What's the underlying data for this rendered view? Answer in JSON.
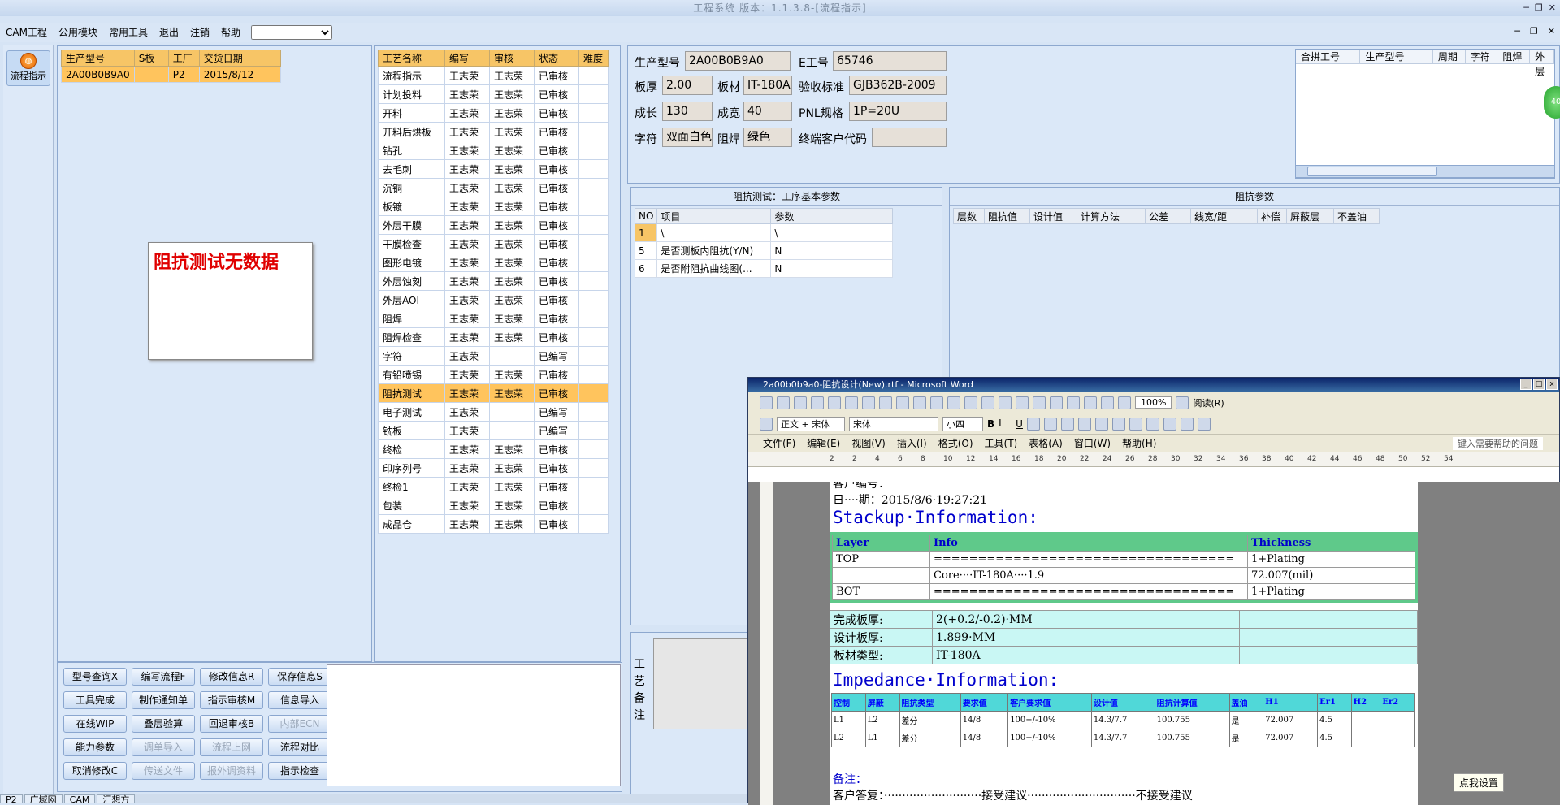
{
  "app": {
    "title": "工程系统 版本：1.1.3.8-[流程指示]",
    "menu": [
      "CAM工程",
      "公用模块",
      "常用工具",
      "退出",
      "注销",
      "帮助"
    ],
    "menu_select_value": ""
  },
  "leftbar": {
    "flow_button": "流程指示"
  },
  "orders": {
    "headers": [
      "生产型号",
      "S板",
      "工厂",
      "交货日期"
    ],
    "rows": [
      [
        "2A00B0B9A0",
        "",
        "P2",
        "2015/8/12"
      ]
    ]
  },
  "message": "阻抗测试无数据",
  "process": {
    "headers": [
      "工艺名称",
      "编写",
      "审核",
      "状态",
      "难度"
    ],
    "rows": [
      [
        "流程指示",
        "王志荣",
        "王志荣",
        "已审核",
        ""
      ],
      [
        "计划投料",
        "王志荣",
        "王志荣",
        "已审核",
        ""
      ],
      [
        "开料",
        "王志荣",
        "王志荣",
        "已审核",
        ""
      ],
      [
        "开料后烘板",
        "王志荣",
        "王志荣",
        "已审核",
        ""
      ],
      [
        "钻孔",
        "王志荣",
        "王志荣",
        "已审核",
        ""
      ],
      [
        "去毛刺",
        "王志荣",
        "王志荣",
        "已审核",
        ""
      ],
      [
        "沉铜",
        "王志荣",
        "王志荣",
        "已审核",
        ""
      ],
      [
        "板镀",
        "王志荣",
        "王志荣",
        "已审核",
        ""
      ],
      [
        "外层干膜",
        "王志荣",
        "王志荣",
        "已审核",
        ""
      ],
      [
        "干膜检查",
        "王志荣",
        "王志荣",
        "已审核",
        ""
      ],
      [
        "图形电镀",
        "王志荣",
        "王志荣",
        "已审核",
        ""
      ],
      [
        "外层蚀刻",
        "王志荣",
        "王志荣",
        "已审核",
        ""
      ],
      [
        "外层AOI",
        "王志荣",
        "王志荣",
        "已审核",
        ""
      ],
      [
        "阻焊",
        "王志荣",
        "王志荣",
        "已审核",
        ""
      ],
      [
        "阻焊检查",
        "王志荣",
        "王志荣",
        "已审核",
        ""
      ],
      [
        "字符",
        "王志荣",
        "",
        "已编写",
        ""
      ],
      [
        "有铅喷锡",
        "王志荣",
        "王志荣",
        "已审核",
        ""
      ],
      [
        "阻抗测试",
        "王志荣",
        "王志荣",
        "已审核",
        ""
      ],
      [
        "电子测试",
        "王志荣",
        "",
        "已编写",
        ""
      ],
      [
        "铣板",
        "王志荣",
        "",
        "已编写",
        ""
      ],
      [
        "终检",
        "王志荣",
        "王志荣",
        "已审核",
        ""
      ],
      [
        "印序列号",
        "王志荣",
        "王志荣",
        "已审核",
        ""
      ],
      [
        "终检1",
        "王志荣",
        "王志荣",
        "已审核",
        ""
      ],
      [
        "包装",
        "王志荣",
        "王志荣",
        "已审核",
        ""
      ],
      [
        "成品仓",
        "王志荣",
        "王志荣",
        "已审核",
        ""
      ]
    ],
    "selected_index": 17
  },
  "buttons": [
    [
      "型号查询X",
      "编写流程F",
      "修改信息R",
      "保存信息S"
    ],
    [
      "工具完成",
      "制作通知单",
      "指示审核M",
      "信息导入"
    ],
    [
      "在线WIP",
      "叠层验算",
      "回退审核B",
      "内部ECN"
    ],
    [
      "能力参数",
      "调单导入",
      "流程上网",
      "流程对比"
    ],
    [
      "取消修改C",
      "传送文件",
      "报外调资料",
      "指示检查"
    ]
  ],
  "disabled_buttons": [
    "内部ECN",
    "调单导入",
    "流程上网",
    "传送文件",
    "报外调资料"
  ],
  "info": {
    "prod_label": "生产型号",
    "prod": "2A00B0B9A0",
    "e_label": "E工号",
    "e": "65746",
    "thick_label": "板厚",
    "thick": "2.00",
    "mat_label": "板材",
    "mat": "IT-180A",
    "std_label": "验收标准",
    "std": "GJB362B-2009",
    "len_label": "成长",
    "len": "130",
    "wid_label": "成宽",
    "wid": "40",
    "pnl_label": "PNL规格",
    "pnl": "1P=20U",
    "char_label": "字符",
    "char": "双面白色",
    "mask_label": "阻焊",
    "mask": "绿色",
    "cust_label": "终端客户代码",
    "cust": ""
  },
  "merge_headers": [
    "合拼工号",
    "生产型号",
    "周期",
    "字符",
    "阻焊",
    "外层"
  ],
  "badge": "40",
  "imp_basic": {
    "title": "阻抗测试：工序基本参数",
    "headers": [
      "NO",
      "项目",
      "参数"
    ],
    "rows": [
      [
        "1",
        "\\",
        "\\"
      ],
      [
        "5",
        "是否测板内阻抗(Y/N)",
        "N"
      ],
      [
        "6",
        "是否附阻抗曲线图(...",
        "N"
      ]
    ]
  },
  "imp_params": {
    "title": "阻抗参数",
    "headers": [
      "层数",
      "阻抗值",
      "设计值",
      "计算方法",
      "公差",
      "线宽/距",
      "补偿",
      "屏蔽层",
      "不盖油"
    ]
  },
  "remark_label": "工艺备注",
  "word": {
    "title": "2a00b0b9a0-阻抗设计(New).rtf - Microsoft Word",
    "zoom": "100%",
    "read": "阅读(R)",
    "style": "正文 + 宋体",
    "font": "宋体",
    "size": "小四",
    "menu": [
      "文件(F)",
      "编辑(E)",
      "视图(V)",
      "插入(I)",
      "格式(O)",
      "工具(T)",
      "表格(A)",
      "窗口(W)",
      "帮助(H)"
    ],
    "help_box": "键入需要帮助的问题",
    "ruler": [
      "2",
      "2",
      "4",
      "6",
      "8",
      "10",
      "12",
      "14",
      "16",
      "18",
      "20",
      "22",
      "24",
      "26",
      "28",
      "30",
      "32",
      "34",
      "36",
      "38",
      "40",
      "42",
      "44",
      "46",
      "48",
      "50",
      "52",
      "54"
    ],
    "cust_no": "客户编号：",
    "date": "日····期：2015/8/6·19:27:21",
    "stack_head": "Stackup·Information:",
    "stack_cols": [
      "Layer",
      "Info",
      "Thickness"
    ],
    "stack_rows": [
      [
        "TOP",
        "==================================",
        "1+Plating"
      ],
      [
        "",
        "Core····IT-180A····1.9",
        "72.007(mil)"
      ],
      [
        "BOT",
        "==================================",
        "1+Plating"
      ]
    ],
    "thick_rows": [
      [
        "完成板厚:",
        "2(+0.2/-0.2)·MM",
        ""
      ],
      [
        "设计板厚:",
        "1.899·MM",
        ""
      ],
      [
        "板材类型:",
        "IT-180A",
        ""
      ]
    ],
    "imp_head": "Impedance·Information:",
    "imp_cols": [
      "控制",
      "屏蔽",
      "阻抗类型",
      "要求值",
      "客户要求值",
      "设计值",
      "阻抗计算值",
      "盖油",
      "H1",
      "Er1",
      "H2",
      "Er2"
    ],
    "imp_rows": [
      [
        "L1",
        "L2",
        "差分",
        "14/8",
        "100+/-10%",
        "14.3/7.7",
        "100.755",
        "是",
        "72.007",
        "4.5",
        "",
        ""
      ],
      [
        "L2",
        "L1",
        "差分",
        "14/8",
        "100+/-10%",
        "14.3/7.7",
        "100.755",
        "是",
        "72.007",
        "4.5",
        "",
        ""
      ]
    ],
    "remark": "备注：",
    "reply": "客户答复：···························接受建议······························不接受建议",
    "tip": "点我设置"
  },
  "bottom_tabs": [
    "P2",
    "广域网",
    "CAM",
    "汇想方"
  ]
}
